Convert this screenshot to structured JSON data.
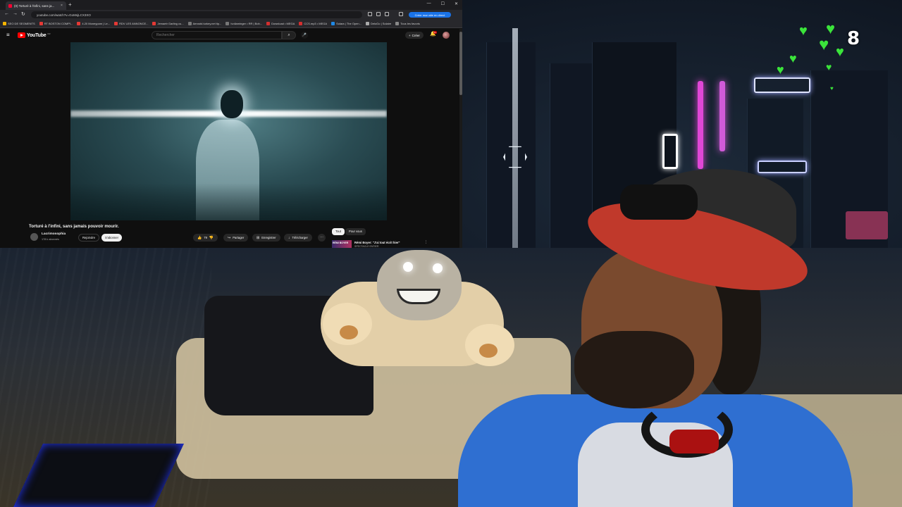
{
  "browser": {
    "tab_title": "(0) Torturé à l'infini, sans ja...",
    "tab_close": "×",
    "new_tab": "+",
    "window_controls": [
      "—",
      "☐",
      "✕"
    ],
    "nav": {
      "back": "←",
      "forward": "→",
      "reload": "↻"
    },
    "url": "youtube.com/watch?v=GoMsjLCX3XO",
    "promo_label": "Créer mon site en direct",
    "bookmarks": [
      "SEO DE SEGMENTS",
      "RT BOSTON COMPI...",
      "4.20 Moneypam | Le...",
      "RDV LES ANNONCE...",
      "Jemaetr Garling cu...",
      "Aerostd.turkey.net tip...",
      "Ivoliaminger • RR | Boh...",
      "Download • MEGA",
      "CCS.mp3 • MEGA",
      "Solara | The Open...",
      "DeloGo | Solaire",
      "Tous les favoris"
    ]
  },
  "youtube": {
    "hamburger": "≡",
    "logo_word": "YouTube",
    "logo_sup": "FR",
    "search_placeholder": "Rechercher",
    "search_icon": "⌕",
    "mic_icon": "🎤",
    "create_label": "Créer",
    "create_icon": "+",
    "bell_icon": "🔔",
    "bell_badge": "9+",
    "video_title": "Torturé à l'infini, sans jamais pouvoir mourir.",
    "channel_name": "Lacrimosophia",
    "channel_subs": "178 k abonnés",
    "join_label": "Rejoindre",
    "subscribe_label": "S'abonner",
    "actions": {
      "like_icon": "👍",
      "like_count": "79",
      "dislike_icon": "👎",
      "share_icon": "↪",
      "share_label": "Partager",
      "save_icon": "⊞",
      "save_label": "Enregistrer",
      "download_icon": "↓",
      "download_label": "Télécharger",
      "more": "⋯"
    },
    "chips": [
      "Tout",
      "Pour vous"
    ],
    "recommendation": {
      "thumb_text": "RÉMI BOYER",
      "title": "Rémi Boyer: \"J'ai tout écrit hier\"",
      "subtitle": "SPECTACLE ENTIER",
      "more": "⋮"
    }
  },
  "overlay": {
    "viewer_count": "8",
    "heart_glyph": "♥",
    "heart_color": "#3be43b"
  }
}
